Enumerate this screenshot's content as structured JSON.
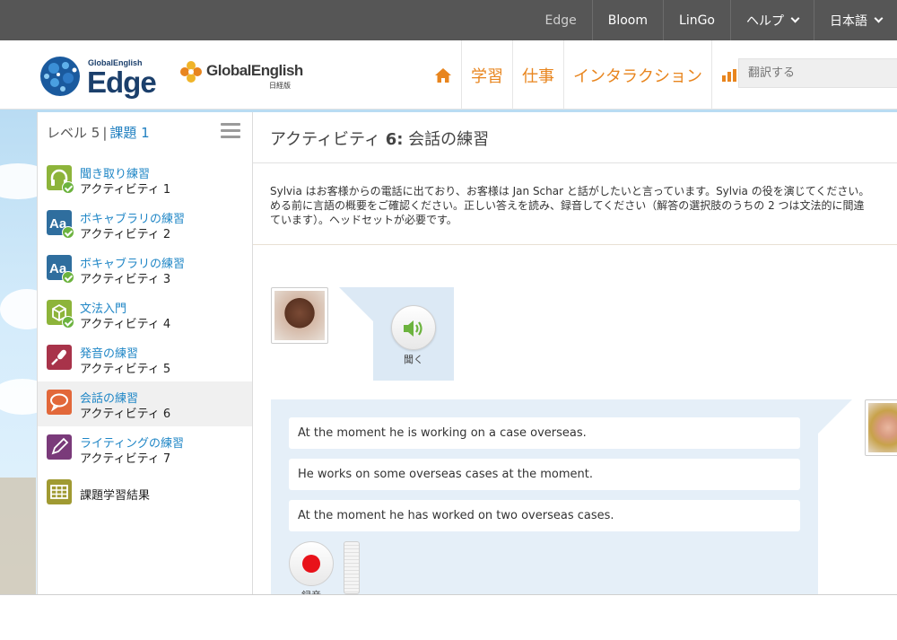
{
  "topbar": {
    "items": [
      {
        "label": "Edge"
      },
      {
        "label": "Bloom"
      },
      {
        "label": "LinGo"
      },
      {
        "label": "ヘルプ"
      },
      {
        "label": "日本語"
      }
    ]
  },
  "header": {
    "logo_edge_small": "GlobalEnglish",
    "logo_edge_big": "Edge",
    "logo_ge_name": "GlobalEnglish",
    "logo_ge_sub": "日経版",
    "nav": [
      {
        "label": "学習"
      },
      {
        "label": "仕事"
      },
      {
        "label": "インタラクション"
      }
    ],
    "translate_placeholder": "翻訳する"
  },
  "sidebar": {
    "level": "レベル 5",
    "separator": "|",
    "task": "課題 1",
    "items": [
      {
        "title": "聞き取り練習",
        "sub": "アクティビティ 1",
        "icon": "headphones-icon",
        "color": "#8db43a",
        "completed": true
      },
      {
        "title": "ボキャブラリの練習",
        "sub": "アクティビティ 2",
        "icon": "vocabulary-icon",
        "color": "#2f6e9e",
        "completed": true
      },
      {
        "title": "ボキャブラリの練習",
        "sub": "アクティビティ 3",
        "icon": "vocabulary-icon",
        "color": "#2f6e9e",
        "completed": true
      },
      {
        "title": "文法入門",
        "sub": "アクティビティ 4",
        "icon": "grammar-box-icon",
        "color": "#8db43a",
        "completed": true
      },
      {
        "title": "発音の練習",
        "sub": "アクティビティ 5",
        "icon": "microphone-icon",
        "color": "#a8334a",
        "completed": false
      },
      {
        "title": "会話の練習",
        "sub": "アクティビティ 6",
        "icon": "speech-bubble-icon",
        "color": "#e2683a",
        "completed": false,
        "active": true
      },
      {
        "title": "ライティングの練習",
        "sub": "アクティビティ 7",
        "icon": "pencil-icon",
        "color": "#7a3a7a",
        "completed": false
      },
      {
        "title": "課題学習結果",
        "sub": "",
        "icon": "results-grid-icon",
        "color": "#a09a32",
        "completed": false
      }
    ]
  },
  "main": {
    "title_prefix": "アクティビティ",
    "title_num": "6:",
    "title_name": "会話の練習",
    "instructions": [
      "Sylvia はお客様からの電話に出ており、お客様は Jan Schar と話がしたいと言っています。Sylvia の役を演じてください。",
      "める前に言語の概要をご確認ください。正しい答えを読み、録音してください（解答の選択肢のうちの 2 つは文法的に間違",
      "ています）。ヘッドセットが必要です。"
    ],
    "listen_label": "聞く",
    "choices": [
      "At the moment he is working on a case overseas.",
      "He works on some overseas cases at the moment.",
      "At the moment he has worked on two overseas cases."
    ],
    "record_label": "録音"
  },
  "colors": {
    "accent_orange": "#e8851e",
    "link_blue": "#1f86c6",
    "panel_blue": "#e5eff8",
    "record_red": "#e8121a",
    "speaker_green": "#6cb33e"
  }
}
